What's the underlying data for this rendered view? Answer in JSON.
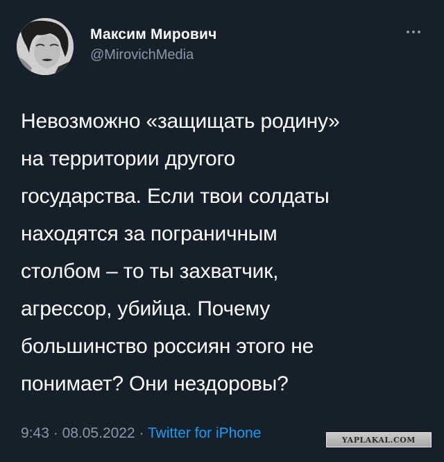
{
  "tweet": {
    "author": {
      "name": "Максим Мирович",
      "handle": "@MirovichMedia"
    },
    "more_icon": "more-horizontal-icon",
    "text_lines": [
      "Невозможно «защищать родину»",
      "на территории другого",
      "государства. Если твои солдаты",
      "находятся за пограничным",
      "столбом – то ты захватчик,",
      "агрессор, убийца. Почему",
      "большинство россиян этого не",
      "понимает? Они нездоровы?"
    ],
    "time": "9:43",
    "separator": "·",
    "date": "08.05.2022",
    "source": "Twitter for iPhone"
  },
  "watermark": {
    "text": "YAPLAKAL.COM"
  },
  "colors": {
    "background": "#15202b",
    "text": "#ffffff",
    "secondary": "#8b98a5",
    "link": "#1d9bf0"
  }
}
